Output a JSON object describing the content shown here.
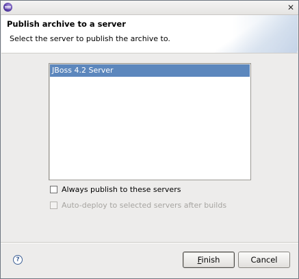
{
  "window": {
    "title": ""
  },
  "banner": {
    "title": "Publish archive to a server",
    "description": "Select the server to publish the archive to."
  },
  "servers": {
    "items": [
      "JBoss 4.2 Server"
    ],
    "selected_index": 0
  },
  "options": {
    "always_publish": {
      "label": "Always publish to these servers",
      "checked": false,
      "enabled": true
    },
    "auto_deploy": {
      "label": "Auto-deploy to selected servers after builds",
      "checked": false,
      "enabled": false
    }
  },
  "footer": {
    "help_icon": "help-icon",
    "finish": {
      "mnemonic": "F",
      "rest": "inish"
    },
    "cancel_label": "Cancel"
  },
  "colors": {
    "selection": "#5c87bd",
    "dialog_bg": "#edeceb"
  }
}
